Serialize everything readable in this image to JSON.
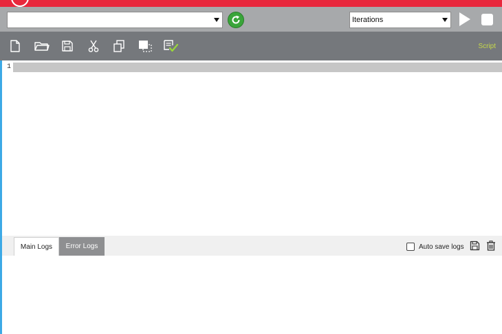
{
  "header": {
    "accent_color": "#e8273c"
  },
  "toolbar": {
    "script_select_value": "",
    "refresh_icon": "refresh-icon",
    "iterations_label": "Iterations",
    "play_icon": "play-icon",
    "stop_icon": "stop-icon"
  },
  "script_toolbar": {
    "tools": [
      "new-file-icon",
      "open-folder-icon",
      "save-icon",
      "cut-icon",
      "copy-icon",
      "paste-icon",
      "validate-icon"
    ],
    "label": "Script",
    "label_color": "#c7d94a"
  },
  "editor": {
    "line_number": "1"
  },
  "logs": {
    "tabs": [
      "Main Logs",
      "Error Logs"
    ],
    "active_tab": "Main Logs",
    "auto_save_label": "Auto save logs",
    "auto_save_checked": false
  }
}
